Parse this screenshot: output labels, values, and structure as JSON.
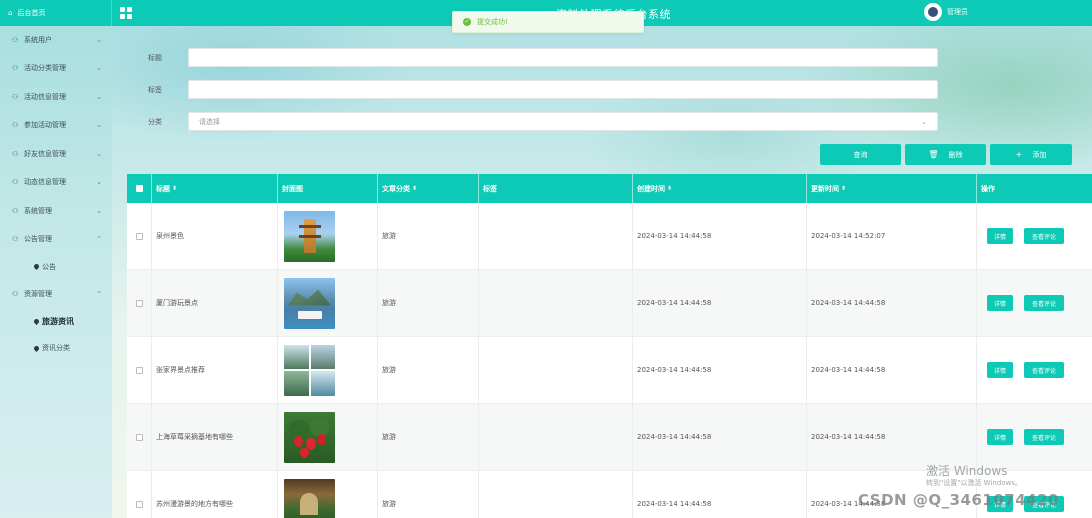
{
  "brand": {
    "label": "后台首页"
  },
  "header": {
    "title": "资料处理系统后台系统",
    "user": "管理员"
  },
  "toast": {
    "text": "提交成功!"
  },
  "sidebar": {
    "items": [
      {
        "label": "系统用户",
        "chevron": "⌄"
      },
      {
        "label": "活动分类管理",
        "chevron": "⌄"
      },
      {
        "label": "活动信息管理",
        "chevron": "⌄"
      },
      {
        "label": "参加活动管理",
        "chevron": "⌄"
      },
      {
        "label": "好友信息管理",
        "chevron": "⌄"
      },
      {
        "label": "动态信息管理",
        "chevron": "⌄"
      },
      {
        "label": "系统管理",
        "chevron": "⌄"
      },
      {
        "label": "公告管理",
        "chevron": "⌃"
      },
      {
        "label": "公告",
        "sub": true
      },
      {
        "label": "资源管理",
        "chevron": "⌃"
      },
      {
        "label": "旅游资讯",
        "sub": true,
        "active": true
      },
      {
        "label": "资讯分类",
        "sub": true
      }
    ]
  },
  "search": {
    "title_label": "标题",
    "tag_label": "标签",
    "category_label": "分类",
    "category_placeholder": "请选择",
    "category_chevron": "⌄"
  },
  "toolbar": {
    "query": "查询",
    "delete": "删除",
    "add": "添加"
  },
  "table": {
    "headers": [
      "标题",
      "封面图",
      "文章分类",
      "标签",
      "创建时间",
      "更新时间",
      "操作"
    ],
    "sort_mark": "⬍",
    "rows": [
      {
        "title": "泉州景色",
        "category": "旅游",
        "tag": "",
        "created": "2024-03-14 14:44:58",
        "updated": "2024-03-14 14:52:07",
        "thumb": "pagoda"
      },
      {
        "title": "厦门游玩景点",
        "category": "旅游",
        "tag": "",
        "created": "2024-03-14 14:44:58",
        "updated": "2024-03-14 14:44:58",
        "thumb": "boat"
      },
      {
        "title": "张家界景点推荐",
        "category": "旅游",
        "tag": "",
        "created": "2024-03-14 14:44:58",
        "updated": "2024-03-14 14:44:58",
        "thumb": "mountains"
      },
      {
        "title": "上海草莓采摘基地有哪些",
        "category": "旅游",
        "tag": "",
        "created": "2024-03-14 14:44:58",
        "updated": "2024-03-14 14:44:58",
        "thumb": "strawberry"
      },
      {
        "title": "苏州漫游景的地方有哪些",
        "category": "旅游",
        "tag": "",
        "created": "2024-03-14 14:44:58",
        "updated": "2024-03-14 14:44:58",
        "thumb": "garden"
      }
    ],
    "detail_label": "详情",
    "comment_label": "查看评论"
  },
  "watermark": {
    "line1": "激活 Windows",
    "line2": "转到\"设置\"以激活 Windows。"
  },
  "csdn": "CSDN @Q_3461074420"
}
